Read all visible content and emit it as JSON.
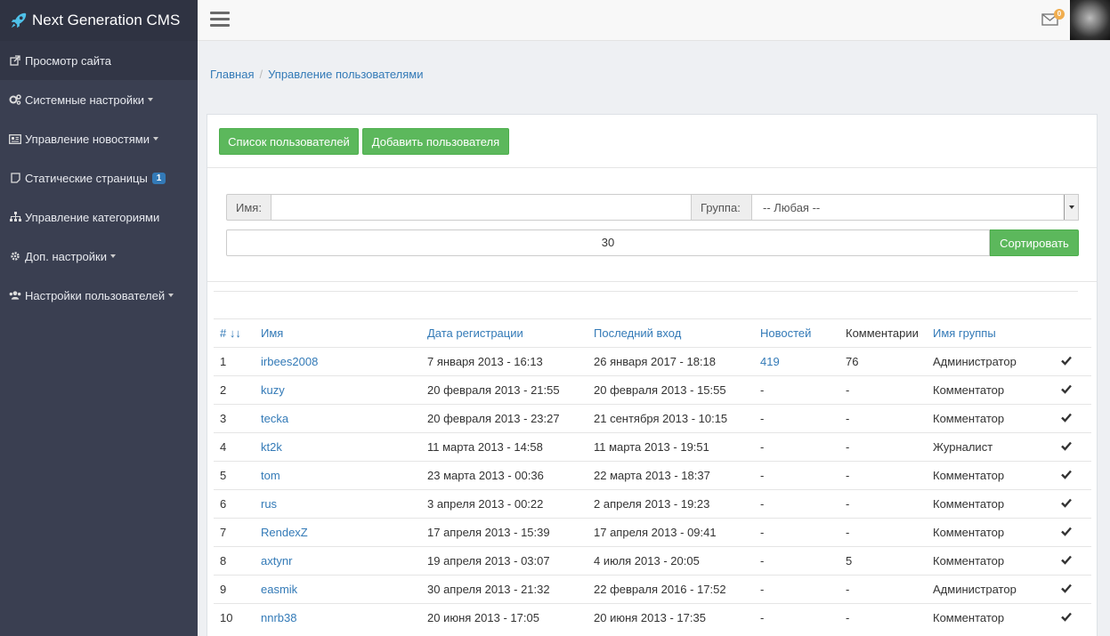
{
  "brand": {
    "title": "Next Generation CMS",
    "icon": "rocket-icon"
  },
  "sidebar": {
    "items": [
      {
        "label": "Просмотр сайта",
        "icon": "external-link-icon",
        "caret": false
      },
      {
        "label": "Системные настройки",
        "icon": "gears-icon",
        "caret": true
      },
      {
        "label": "Управление новостями",
        "icon": "newspaper-icon",
        "caret": true
      },
      {
        "label": "Статические страницы",
        "icon": "page-icon",
        "caret": false,
        "badge": "1"
      },
      {
        "label": "Управление категориями",
        "icon": "sitemap-icon",
        "caret": false
      },
      {
        "label": "Доп. настройки",
        "icon": "gear-icon",
        "caret": true
      },
      {
        "label": "Настройки пользователей",
        "icon": "users-icon",
        "caret": true
      }
    ]
  },
  "topbar": {
    "mail_count": "0"
  },
  "breadcrumb": {
    "home": "Главная",
    "current": "Управление пользователями"
  },
  "actions": {
    "list_users": "Список пользователей",
    "add_user": "Добавить пользователя"
  },
  "filters": {
    "name_label": "Имя:",
    "name_value": "",
    "group_label": "Группа:",
    "group_selected": "-- Любая --",
    "per_page": "30",
    "sort_button": "Сортировать"
  },
  "table": {
    "headers": {
      "num": "# ↓↓",
      "name": "Имя",
      "reg": "Дата регистрации",
      "last": "Последний вход",
      "news": "Новостей",
      "comments": "Комментарии",
      "group": "Имя группы"
    },
    "rows": [
      {
        "n": "1",
        "name": "irbees2008",
        "reg": "7 января 2013 - 16:13",
        "last": "26 января 2017 - 18:18",
        "news": "419",
        "comments": "76",
        "group": "Администратор"
      },
      {
        "n": "2",
        "name": "kuzy",
        "reg": "20 февраля 2013 - 21:55",
        "last": "20 февраля 2013 - 15:55",
        "news": "-",
        "comments": "-",
        "group": "Комментатор"
      },
      {
        "n": "3",
        "name": "tecka",
        "reg": "20 февраля 2013 - 23:27",
        "last": "21 сентября 2013 - 10:15",
        "news": "-",
        "comments": "-",
        "group": "Комментатор"
      },
      {
        "n": "4",
        "name": "kt2k",
        "reg": "11 марта 2013 - 14:58",
        "last": "11 марта 2013 - 19:51",
        "news": "-",
        "comments": "-",
        "group": "Журналист"
      },
      {
        "n": "5",
        "name": "tom",
        "reg": "23 марта 2013 - 00:36",
        "last": "22 марта 2013 - 18:37",
        "news": "-",
        "comments": "-",
        "group": "Комментатор"
      },
      {
        "n": "6",
        "name": "rus",
        "reg": "3 апреля 2013 - 00:22",
        "last": "2 апреля 2013 - 19:23",
        "news": "-",
        "comments": "-",
        "group": "Комментатор"
      },
      {
        "n": "7",
        "name": "RendexZ",
        "reg": "17 апреля 2013 - 15:39",
        "last": "17 апреля 2013 - 09:41",
        "news": "-",
        "comments": "-",
        "group": "Комментатор"
      },
      {
        "n": "8",
        "name": "axtynr",
        "reg": "19 апреля 2013 - 03:07",
        "last": "4 июля 2013 - 20:05",
        "news": "-",
        "comments": "5",
        "group": "Комментатор"
      },
      {
        "n": "9",
        "name": "easmik",
        "reg": "30 апреля 2013 - 21:32",
        "last": "22 февраля 2016 - 17:52",
        "news": "-",
        "comments": "-",
        "group": "Администратор"
      },
      {
        "n": "10",
        "name": "nnrb38",
        "reg": "20 июня 2013 - 17:05",
        "last": "20 июня 2013 - 17:35",
        "news": "-",
        "comments": "-",
        "group": "Комментатор"
      }
    ]
  },
  "colors": {
    "sidebar": "#3a3f51",
    "brand_bg": "#2f3342",
    "accent": "#337ab7",
    "success": "#5cb85c",
    "warning": "#f0ad4e"
  }
}
